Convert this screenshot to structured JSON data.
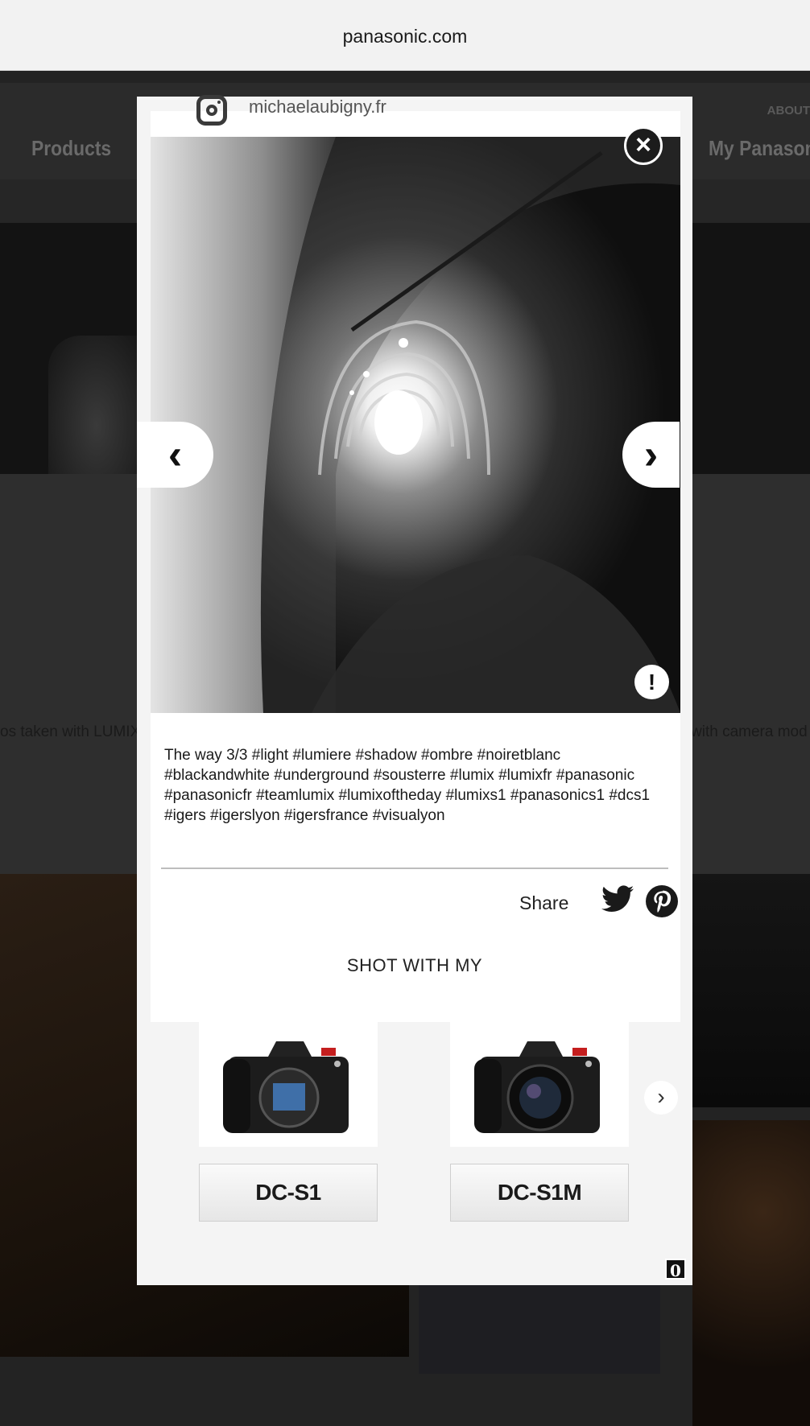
{
  "browser": {
    "url": "panasonic.com"
  },
  "background_page": {
    "nav_about": "ABOUT",
    "nav_products": "Products",
    "nav_my_panasonic": "My Panason",
    "left_text": "os taken with LUMIX",
    "right_text": "with camera mod"
  },
  "modal": {
    "username": "michaelaubigny.fr",
    "close_icon": "×",
    "prev_icon": "‹",
    "next_icon": "›",
    "report_icon": "!",
    "caption": "The way 3/3 #light #lumiere #shadow #ombre #noiretblanc #blackandwhite #underground #sousterre #lumix #lumixfr #panasonic #panasonicfr #teamlumix #lumixoftheday #lumixs1 #panasonics1 #dcs1 #igers #igerslyon #igersfrance #visualyon",
    "share_label": "Share",
    "shot_with_title": "SHOT WITH MY",
    "products": [
      {
        "name": "DC-S1"
      },
      {
        "name": "DC-S1M"
      }
    ],
    "carousel_next_icon": "›",
    "badge": "0"
  }
}
